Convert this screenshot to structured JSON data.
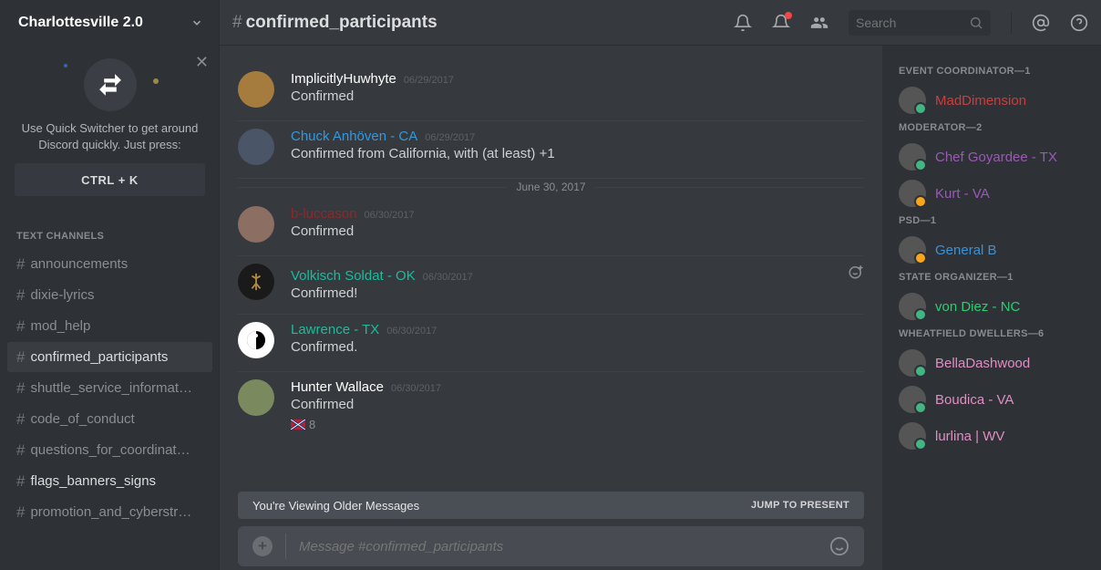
{
  "server": {
    "name": "Charlottesville 2.0"
  },
  "channel": {
    "prefix": "#",
    "name": "confirmed_participants"
  },
  "search": {
    "placeholder": "Search"
  },
  "quick_switcher": {
    "text": "Use Quick Switcher to get around Discord quickly. Just press:",
    "button": "CTRL + K"
  },
  "channels_header": "TEXT CHANNELS",
  "channels": [
    {
      "name": "announcements",
      "active": false,
      "unread": false
    },
    {
      "name": "dixie-lyrics",
      "active": false,
      "unread": false
    },
    {
      "name": "mod_help",
      "active": false,
      "unread": false
    },
    {
      "name": "confirmed_participants",
      "active": true,
      "unread": true
    },
    {
      "name": "shuttle_service_informat…",
      "active": false,
      "unread": false
    },
    {
      "name": "code_of_conduct",
      "active": false,
      "unread": false
    },
    {
      "name": "questions_for_coordinat…",
      "active": false,
      "unread": false
    },
    {
      "name": "flags_banners_signs",
      "active": false,
      "unread": true
    },
    {
      "name": "promotion_and_cyberstr…",
      "active": false,
      "unread": false
    }
  ],
  "date_divider": "June 30, 2017",
  "messages": [
    {
      "user": "ImplicitlyHuwhyte",
      "color": "c-white",
      "time": "06/29/2017",
      "text": "Confirmed",
      "av": "av1"
    },
    {
      "user": "Chuck Anhöven - CA",
      "color": "c-blue1",
      "time": "06/29/2017",
      "text": "Confirmed from California, with (at least) +1",
      "av": "av2"
    },
    {
      "user": "b-luccason",
      "color": "c-dred",
      "time": "06/30/2017",
      "text": "Confirmed",
      "av": "av3"
    },
    {
      "user": "Volkisch Soldat - OK",
      "color": "c-teal",
      "time": "06/30/2017",
      "text": "Confirmed!",
      "av": "av4",
      "add_react": true
    },
    {
      "user": "Lawrence - TX",
      "color": "c-teal",
      "time": "06/30/2017",
      "text": "Confirmed.",
      "av": "av5"
    },
    {
      "user": "Hunter Wallace",
      "color": "c-white",
      "time": "06/30/2017",
      "text": "Confirmed",
      "av": "av6",
      "reaction_count": "8"
    }
  ],
  "older_banner": {
    "text": "You're Viewing Older Messages",
    "jump": "JUMP TO PRESENT"
  },
  "input": {
    "placeholder": "Message #confirmed_participants"
  },
  "roles": [
    {
      "header": "EVENT COORDINATOR—1",
      "members": [
        {
          "name": "MadDimension",
          "color": "c-red",
          "status": "online"
        }
      ]
    },
    {
      "header": "MODERATOR—2",
      "members": [
        {
          "name": "Chef Goyardee - TX",
          "color": "c-purple",
          "status": "online"
        },
        {
          "name": "Kurt - VA",
          "color": "c-purple",
          "status": "idle"
        }
      ]
    },
    {
      "header": "PSD—1",
      "members": [
        {
          "name": "General B",
          "color": "c-blue2",
          "status": "idle"
        }
      ]
    },
    {
      "header": "STATE ORGANIZER—1",
      "members": [
        {
          "name": "von Diez - NC",
          "color": "c-green",
          "status": "online"
        }
      ]
    },
    {
      "header": "WHEATFIELD DWELLERS—6",
      "members": [
        {
          "name": "BellaDashwood",
          "color": "c-pink",
          "status": "online"
        },
        {
          "name": "Boudica - VA",
          "color": "c-pink",
          "status": "online"
        },
        {
          "name": "lurlina | WV",
          "color": "c-pink",
          "status": "online"
        }
      ]
    }
  ]
}
